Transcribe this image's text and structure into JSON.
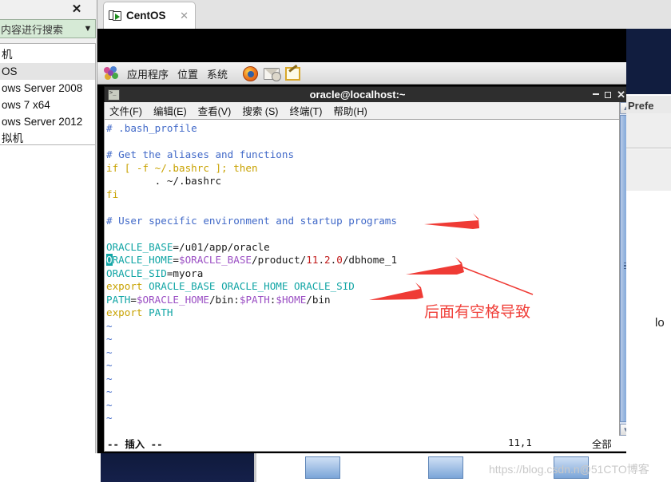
{
  "host": {
    "close_label": "✕",
    "search_text": "内容进行搜索",
    "search_arrow": "▼",
    "vm_items": [
      {
        "label": "机",
        "selected": false
      },
      {
        "label": "OS",
        "selected": true
      },
      {
        "label": "ows Server 2008",
        "selected": false
      },
      {
        "label": "ows 7 x64",
        "selected": false
      },
      {
        "label": "ows Server 2012",
        "selected": false
      },
      {
        "label": "拟机",
        "selected": false
      }
    ]
  },
  "tab": {
    "label": "CentOS",
    "close": "✕"
  },
  "gnome_panel": {
    "menus": [
      "应用程序",
      "位置",
      "系统"
    ],
    "icons": [
      "firefox-icon",
      "mail-icon",
      "text-editor-icon"
    ]
  },
  "terminal": {
    "title": "oracle@localhost:~",
    "window_buttons": {
      "minimize": "–",
      "maximize": "□",
      "close": "✕"
    },
    "menus": [
      "文件(F)",
      "编辑(E)",
      "查看(V)",
      "搜索 (S)",
      "终端(T)",
      "帮助(H)"
    ],
    "status": {
      "mode": "-- 插入 --",
      "position": "11,1",
      "scope": "全部"
    },
    "content_lines": [
      {
        "id": "l1",
        "segments": [
          {
            "t": "# .bash_profile",
            "c": "comment"
          }
        ]
      },
      {
        "id": "l2",
        "segments": [
          {
            "t": "",
            "c": "plain"
          }
        ]
      },
      {
        "id": "l3",
        "segments": [
          {
            "t": "# Get the aliases and functions",
            "c": "comment"
          }
        ]
      },
      {
        "id": "l4",
        "segments": [
          {
            "t": "if [ -f ~/.bashrc ]; then",
            "c": "key"
          }
        ]
      },
      {
        "id": "l5",
        "segments": [
          {
            "t": "        . ~/.bashrc",
            "c": "plain"
          }
        ]
      },
      {
        "id": "l6",
        "segments": [
          {
            "t": "fi",
            "c": "key"
          }
        ]
      },
      {
        "id": "l7",
        "segments": [
          {
            "t": "",
            "c": "plain"
          }
        ]
      },
      {
        "id": "l8",
        "segments": [
          {
            "t": "# User specific environment and startup programs",
            "c": "comment"
          }
        ]
      },
      {
        "id": "l9",
        "segments": [
          {
            "t": "",
            "c": "plain"
          }
        ]
      },
      {
        "id": "l10",
        "segments": [
          {
            "t": "ORACLE_BASE",
            "c": "var"
          },
          {
            "t": "=/u01/app/oracle",
            "c": "plain"
          }
        ]
      },
      {
        "id": "l11",
        "segments": [
          {
            "t": "O",
            "c": "cursor"
          },
          {
            "t": "RACLE_HOME",
            "c": "var"
          },
          {
            "t": "=",
            "c": "plain"
          },
          {
            "t": "$ORACLE_BASE",
            "c": "dollar"
          },
          {
            "t": "/product/",
            "c": "plain"
          },
          {
            "t": "11",
            "c": "num"
          },
          {
            "t": ".",
            "c": "plain"
          },
          {
            "t": "2",
            "c": "num"
          },
          {
            "t": ".",
            "c": "plain"
          },
          {
            "t": "0",
            "c": "num"
          },
          {
            "t": "/dbhome_1",
            "c": "plain"
          }
        ]
      },
      {
        "id": "l12",
        "segments": [
          {
            "t": "ORACLE_SID",
            "c": "var"
          },
          {
            "t": "=myora",
            "c": "plain"
          }
        ]
      },
      {
        "id": "l13",
        "segments": [
          {
            "t": "export ",
            "c": "key"
          },
          {
            "t": "ORACLE_BASE ORACLE_HOME ORACLE_SID",
            "c": "var"
          }
        ]
      },
      {
        "id": "l14",
        "segments": [
          {
            "t": "PATH",
            "c": "var"
          },
          {
            "t": "=",
            "c": "plain"
          },
          {
            "t": "$ORACLE_HOME",
            "c": "dollar"
          },
          {
            "t": "/bin:",
            "c": "plain"
          },
          {
            "t": "$PATH",
            "c": "dollar"
          },
          {
            "t": ":",
            "c": "plain"
          },
          {
            "t": "$HOME",
            "c": "dollar"
          },
          {
            "t": "/bin",
            "c": "plain"
          }
        ]
      },
      {
        "id": "l15",
        "segments": [
          {
            "t": "export ",
            "c": "key"
          },
          {
            "t": "PATH",
            "c": "var"
          }
        ]
      },
      {
        "id": "t1",
        "segments": [
          {
            "t": "~",
            "c": "tilde"
          }
        ]
      },
      {
        "id": "t2",
        "segments": [
          {
            "t": "~",
            "c": "tilde"
          }
        ]
      },
      {
        "id": "t3",
        "segments": [
          {
            "t": "~",
            "c": "tilde"
          }
        ]
      },
      {
        "id": "t4",
        "segments": [
          {
            "t": "~",
            "c": "tilde"
          }
        ]
      },
      {
        "id": "t5",
        "segments": [
          {
            "t": "~",
            "c": "tilde"
          }
        ]
      },
      {
        "id": "t6",
        "segments": [
          {
            "t": "~",
            "c": "tilde"
          }
        ]
      },
      {
        "id": "t7",
        "segments": [
          {
            "t": "~",
            "c": "tilde"
          }
        ]
      },
      {
        "id": "t8",
        "segments": [
          {
            "t": "~",
            "c": "tilde"
          }
        ]
      }
    ]
  },
  "annotation": {
    "text": "后面有空格导致",
    "color": "#f0403a",
    "arrow_count": 3
  },
  "right_window": {
    "prefs_fragment": "Prefe",
    "lo_fragment": "lo"
  },
  "watermark": "https://blog.csdn.n@51CTO博客",
  "colors": {
    "comment": "#4169c8",
    "keyword": "#c8a200",
    "variable": "#11a5a5",
    "dollar": "#9b4fc4",
    "number": "#c01818",
    "annotation_red": "#f0403a",
    "terminal_bg": "#ffffff",
    "vm_bg": "#000000"
  }
}
